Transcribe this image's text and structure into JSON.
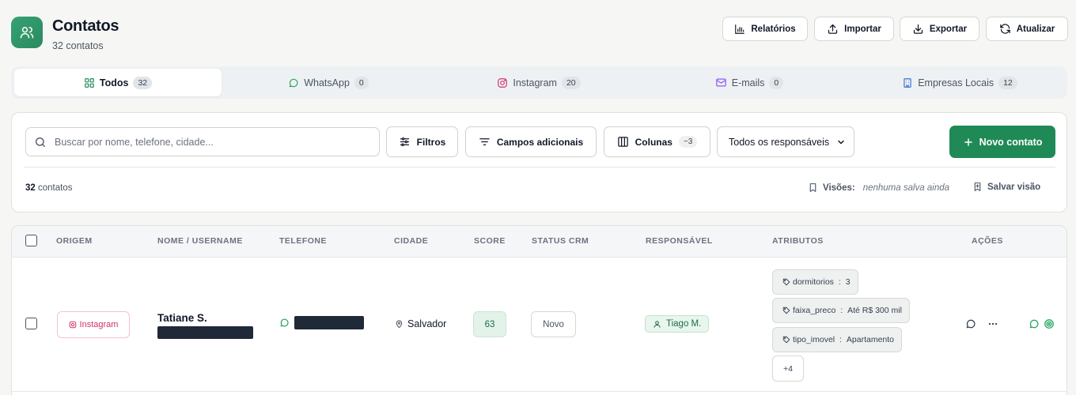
{
  "header": {
    "title": "Contatos",
    "subtitle": "32 contatos",
    "buttons": {
      "reports": "Relatórios",
      "import": "Importar",
      "export": "Exportar",
      "refresh": "Atualizar"
    }
  },
  "tabs": [
    {
      "label": "Todos",
      "count": "32",
      "icon": "grid-icon",
      "active": true
    },
    {
      "label": "WhatsApp",
      "count": "0",
      "icon": "whatsapp-icon"
    },
    {
      "label": "Instagram",
      "count": "20",
      "icon": "instagram-icon"
    },
    {
      "label": "E-mails",
      "count": "0",
      "icon": "mail-icon"
    },
    {
      "label": "Empresas Locais",
      "count": "12",
      "icon": "building-icon"
    }
  ],
  "filters": {
    "search_placeholder": "Buscar por nome, telefone, cidade...",
    "filters_label": "Filtros",
    "additional_fields_label": "Campos adicionais",
    "columns_label": "Colunas",
    "columns_badge": "−3",
    "responsible_select": "Todos os responsáveis",
    "new_contact_label": "Novo contato",
    "count_number": "32",
    "count_label": "contatos",
    "views_label": "Visões:",
    "views_value": "nenhuma salva ainda",
    "save_view_label": "Salvar visão"
  },
  "table": {
    "columns": [
      "ORIGEM",
      "NOME / USERNAME",
      "TELEFONE",
      "CIDADE",
      "SCORE",
      "STATUS CRM",
      "RESPONSÁVEL",
      "ATRIBUTOS",
      "AÇÕES"
    ],
    "rows": [
      {
        "origin": "Instagram",
        "name": "Tatiane S.",
        "city": "Salvador",
        "score": "63",
        "status": "Novo",
        "responsible": "Tiago M.",
        "attributes": [
          {
            "key": "dormitorios",
            "value": "3"
          },
          {
            "key": "faixa_preco",
            "value": "Até R$ 300 mil"
          },
          {
            "key": "tipo_imovel",
            "value": "Apartamento"
          }
        ],
        "more_attributes": "+4"
      }
    ]
  },
  "colors": {
    "accent": "#1f8a56",
    "instagram": "#d0336b",
    "whatsapp": "#25a55f",
    "email": "#8b5cf6",
    "building": "#3b6fd8"
  }
}
